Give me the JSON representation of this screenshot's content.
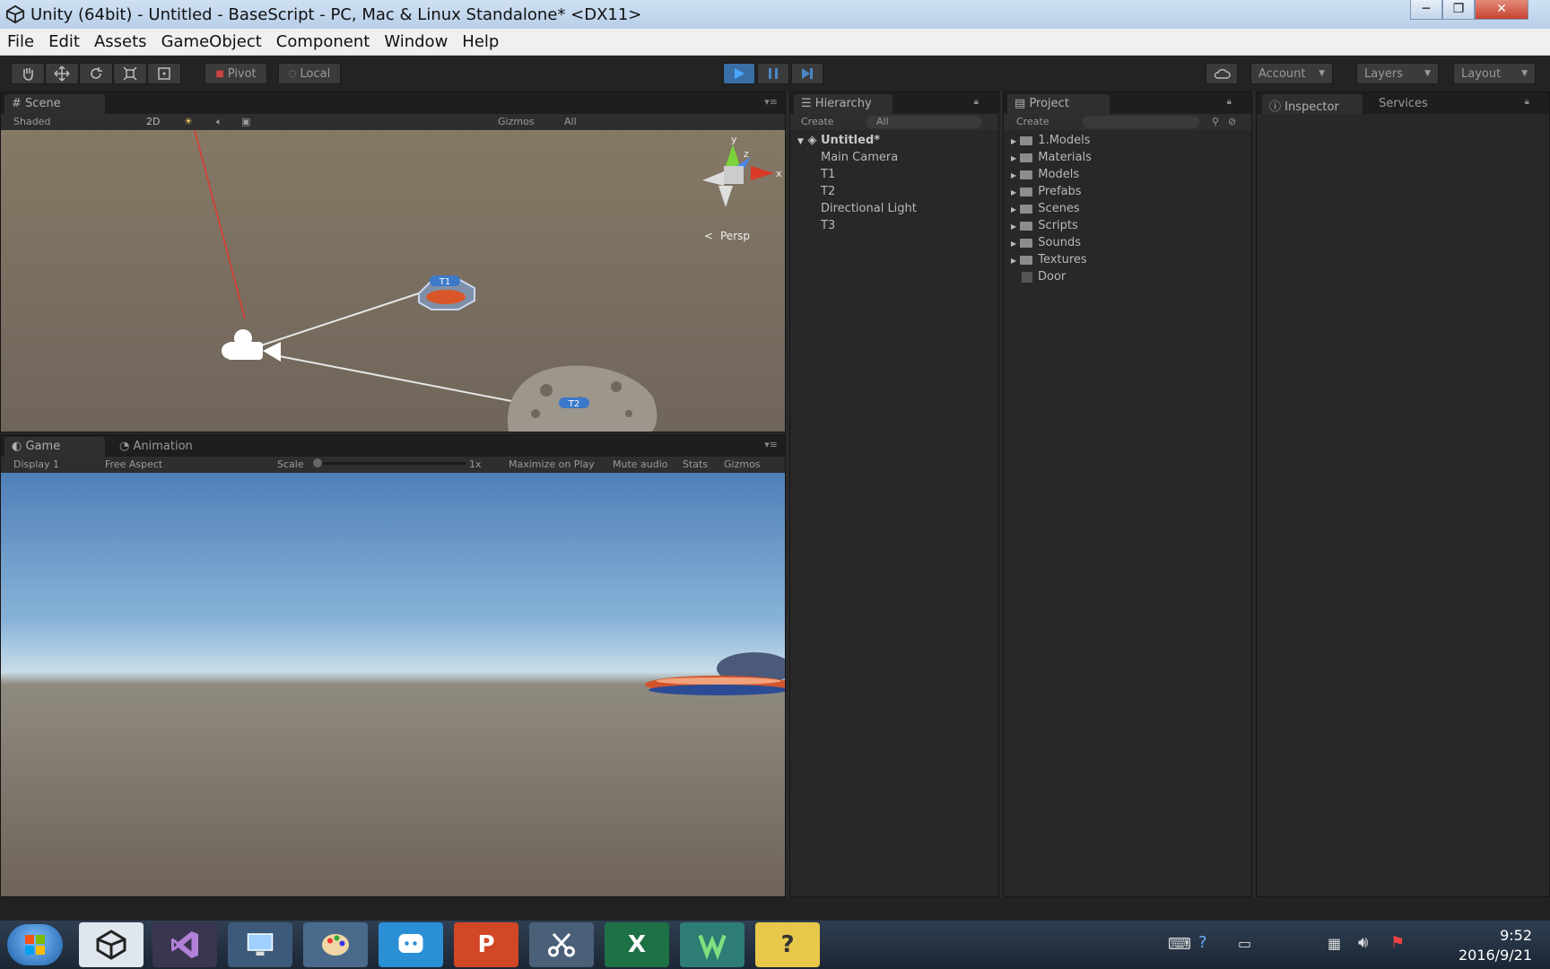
{
  "window": {
    "title": "Unity (64bit) - Untitled - BaseScript - PC, Mac & Linux Standalone* <DX11>",
    "controls": [
      "─",
      "❐",
      "✕"
    ]
  },
  "menu": [
    "File",
    "Edit",
    "Assets",
    "GameObject",
    "Component",
    "Window",
    "Help"
  ],
  "toolbar": {
    "pivot": "Pivot",
    "local": "Local",
    "account": "Account",
    "layers": "Layers",
    "layout": "Layout"
  },
  "scene": {
    "tab": "Scene",
    "shaded": "Shaded",
    "mode_2d": "2D",
    "gizmos": "Gizmos",
    "search": "All",
    "persp": "Persp",
    "axis_x": "x",
    "axis_y": "y",
    "axis_z": "z",
    "label_t1": "T1",
    "label_t2": "T2"
  },
  "game": {
    "tabs": [
      "Game",
      "Animation"
    ],
    "display": "Display 1",
    "aspect": "Free Aspect",
    "scale": "Scale",
    "scale_value": "1x",
    "maximize": "Maximize on Play",
    "mute": "Mute audio",
    "stats": "Stats",
    "gizmos": "Gizmos"
  },
  "hierarchy": {
    "tab": "Hierarchy",
    "create": "Create",
    "search": "All",
    "scene": "Untitled*",
    "items": [
      "Main Camera",
      "T1",
      "T2",
      "Directional Light",
      "T3"
    ]
  },
  "project": {
    "tab": "Project",
    "create": "Create",
    "folders": [
      "1.Models",
      "Materials",
      "Models",
      "Prefabs",
      "Scenes",
      "Scripts",
      "Sounds",
      "Textures",
      "Door"
    ]
  },
  "inspector": {
    "tab": "Inspector",
    "services": "Services"
  },
  "taskbar": {
    "time": "9:52",
    "date": "2016/9/21",
    "apps": [
      "unity-app",
      "visual-studio-app",
      "remote-desktop-app",
      "paint-app",
      "qq-app",
      "powerpoint-app",
      "snipping-app",
      "excel-app",
      "camtasia-app",
      "help-app"
    ],
    "letters": {
      "powerpoint": "P",
      "excel": "X",
      "help": "?"
    }
  }
}
